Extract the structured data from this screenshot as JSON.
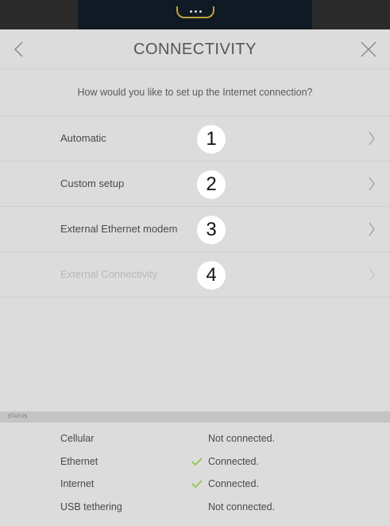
{
  "header": {
    "title": "CONNECTIVITY",
    "back_icon": "chevron-left-icon",
    "close_icon": "close-icon"
  },
  "question": "How would you like to set up the Internet connection?",
  "options": [
    {
      "label": "Automatic",
      "badge": "1",
      "enabled": true
    },
    {
      "label": "Custom setup",
      "badge": "2",
      "enabled": true
    },
    {
      "label": "External Ethernet modem",
      "badge": "3",
      "enabled": true
    },
    {
      "label": "External Connectivity",
      "badge": "4",
      "enabled": false
    }
  ],
  "status": {
    "heading": "STATUS",
    "rows": [
      {
        "name": "Cellular",
        "value": "Not connected.",
        "ok": false
      },
      {
        "name": "Ethernet",
        "value": "Connected.",
        "ok": true
      },
      {
        "name": "Internet",
        "value": "Connected.",
        "ok": true
      },
      {
        "name": "USB tethering",
        "value": "Not connected.",
        "ok": false
      }
    ]
  },
  "colors": {
    "background": "#dcdcdc",
    "check": "#8cc63f",
    "disabled_text": "#b8b8b8"
  }
}
